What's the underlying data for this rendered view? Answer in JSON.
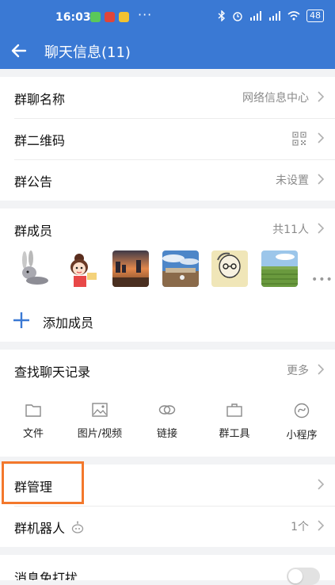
{
  "status_bar": {
    "time": "16:03",
    "battery": "48"
  },
  "header": {
    "title": "聊天信息(11)"
  },
  "group_info": {
    "name_label": "群聊名称",
    "name_value": "网络信息中心",
    "qr_label": "群二维码",
    "notice_label": "群公告",
    "notice_value": "未设置"
  },
  "members": {
    "label": "群成员",
    "count": "共11人",
    "add_label": "添加成员"
  },
  "history": {
    "label": "查找聊天记录",
    "more": "更多",
    "tools": [
      {
        "label": "文件",
        "icon": "folder-icon"
      },
      {
        "label": "图片/视频",
        "icon": "image-icon"
      },
      {
        "label": "链接",
        "icon": "link-icon"
      },
      {
        "label": "群工具",
        "icon": "toolbox-icon"
      },
      {
        "label": "小程序",
        "icon": "mini-program-icon"
      }
    ]
  },
  "management": {
    "label": "群管理",
    "bot_label": "群机器人",
    "bot_count": "1个"
  },
  "settings": {
    "mute_label": "消息免打扰",
    "mute_on": false
  },
  "colors": {
    "header_bg": "#3a79d4",
    "accent": "#3a79d4",
    "highlight": "#f3782c"
  }
}
